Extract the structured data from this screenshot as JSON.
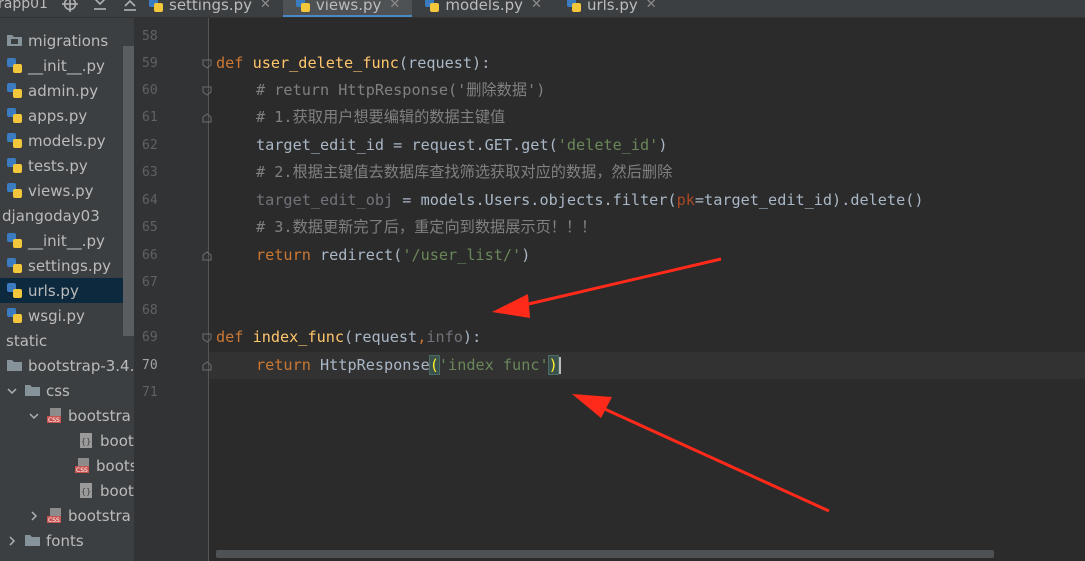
{
  "toolbar": {
    "partial_label": "rapp01"
  },
  "tabs": [
    {
      "label": "settings.py",
      "active": false
    },
    {
      "label": "views.py",
      "active": true
    },
    {
      "label": "models.py",
      "active": false
    },
    {
      "label": "urls.py",
      "active": false
    }
  ],
  "tree": [
    {
      "label": "migrations",
      "icon": "folder-icon"
    },
    {
      "label": "__init__.py",
      "icon": "python-file-icon"
    },
    {
      "label": "admin.py",
      "icon": "python-file-icon"
    },
    {
      "label": "apps.py",
      "icon": "python-file-icon"
    },
    {
      "label": "models.py",
      "icon": "python-file-icon"
    },
    {
      "label": "tests.py",
      "icon": "python-file-icon"
    },
    {
      "label": "views.py",
      "icon": "python-file-icon"
    },
    {
      "label": "djangoday03",
      "icon": "none"
    },
    {
      "label": "__init__.py",
      "icon": "python-file-icon"
    },
    {
      "label": "settings.py",
      "icon": "python-file-icon"
    },
    {
      "label": "urls.py",
      "icon": "python-file-icon",
      "selected": true
    },
    {
      "label": "wsgi.py",
      "icon": "python-file-icon"
    },
    {
      "label": "static",
      "icon": "none"
    },
    {
      "label": "bootstrap-3.4.",
      "icon": "folder-icon"
    },
    {
      "label": "css",
      "icon": "folder-icon",
      "expanded": true
    },
    {
      "label": "bootstra",
      "icon": "css-file-icon",
      "expanded": true
    },
    {
      "label": "boots",
      "icon": "css-map-icon"
    },
    {
      "label": "boots",
      "icon": "css-file-icon"
    },
    {
      "label": "boots",
      "icon": "css-map-icon"
    },
    {
      "label": "bootstra",
      "icon": "css-file-icon",
      "collapsed": true
    },
    {
      "label": "fonts",
      "icon": "folder-icon",
      "collapsed": true
    }
  ],
  "editor": {
    "line_numbers": [
      "58",
      "59",
      "60",
      "61",
      "62",
      "63",
      "64",
      "65",
      "66",
      "67",
      "68",
      "69",
      "70",
      "71"
    ],
    "current_line": "70",
    "code": {
      "l59_def": "def",
      "l59_name": "user_delete_func",
      "l59_rest": "(request):",
      "l60": "# return HttpResponse('删除数据')",
      "l61": "# 1.获取用户想要编辑的数据主键值",
      "l62_a": "target_edit_id = request.GET.get(",
      "l62_str": "'delete_id'",
      "l62_b": ")",
      "l63": "# 2.根据主键值去数据库查找筛选获取对应的数据，然后删除",
      "l64_a": "target_edit_obj",
      "l64_b": " = models.Users.objects.filter(",
      "l64_kw": "pk",
      "l64_c": "=target_edit_id).delete()",
      "l65": "# 3.数据更新完了后，重定向到数据展示页！！！",
      "l66_ret": "return",
      "l66_a": " redirect(",
      "l66_str": "'/user_list/'",
      "l66_b": ")",
      "l69_def": "def",
      "l69_name": "index_func",
      "l69_a": "(request",
      "l69_comma": ",",
      "l69_info": "info",
      "l69_b": "):",
      "l70_ret": "return",
      "l70_a": " HttpResponse",
      "l70_open": "(",
      "l70_str": "'index func'",
      "l70_close": ")"
    }
  },
  "colors": {
    "keyword": "#cc7832",
    "function": "#ffc66d",
    "string": "#6a8759",
    "comment": "#808080",
    "arrow": "#ff2a1a"
  }
}
